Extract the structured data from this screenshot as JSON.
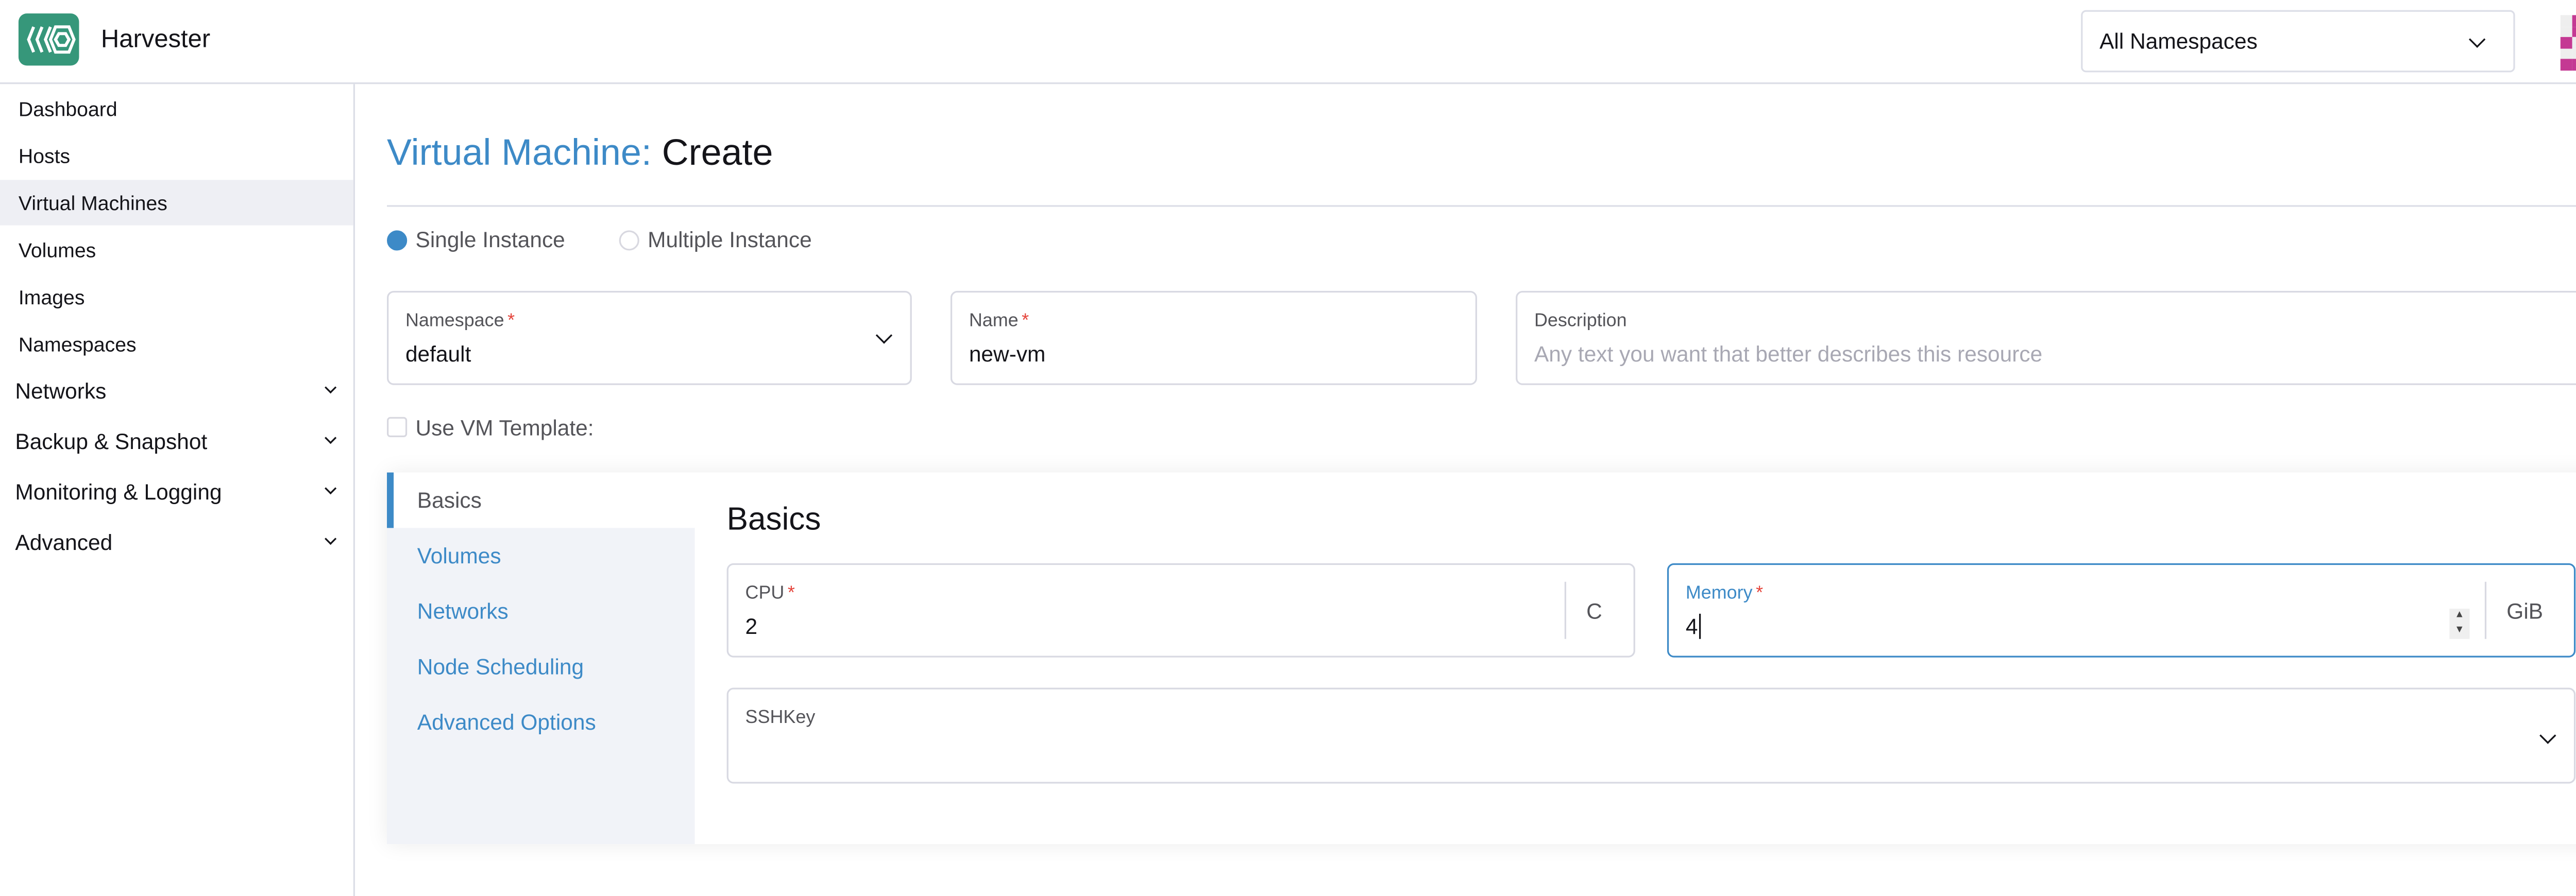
{
  "header": {
    "brand": "Harvester",
    "namespace_select": "All Namespaces",
    "logo_color": "#36977a",
    "avatar_color": "#c43993",
    "avatar_pattern": [
      [
        0,
        1,
        1,
        1,
        0
      ],
      [
        0,
        1,
        0,
        1,
        0
      ],
      [
        1,
        0,
        0,
        0,
        1
      ],
      [
        0,
        0,
        1,
        0,
        0
      ],
      [
        1,
        1,
        1,
        1,
        1
      ]
    ]
  },
  "sidebar": {
    "items": [
      {
        "label": "Dashboard"
      },
      {
        "label": "Hosts"
      },
      {
        "label": "Virtual Machines",
        "active": true
      },
      {
        "label": "Volumes"
      },
      {
        "label": "Images"
      },
      {
        "label": "Namespaces"
      }
    ],
    "groups": [
      {
        "label": "Networks"
      },
      {
        "label": "Backup & Snapshot"
      },
      {
        "label": "Monitoring & Logging"
      },
      {
        "label": "Advanced"
      }
    ]
  },
  "page": {
    "title_kind": "Virtual Machine:",
    "title_action": "Create"
  },
  "instance": {
    "single": "Single Instance",
    "multiple": "Multiple Instance",
    "selected": "single"
  },
  "form": {
    "namespace": {
      "label": "Namespace",
      "value": "default"
    },
    "name": {
      "label": "Name",
      "value": "new-vm"
    },
    "description": {
      "label": "Description",
      "placeholder": "Any text you want that better describes this resource"
    },
    "use_template": {
      "label": "Use VM Template:",
      "checked": false
    }
  },
  "tabs": [
    {
      "label": "Basics",
      "active": true
    },
    {
      "label": "Volumes"
    },
    {
      "label": "Networks"
    },
    {
      "label": "Node Scheduling"
    },
    {
      "label": "Advanced Options"
    }
  ],
  "basics": {
    "heading": "Basics",
    "cpu": {
      "label": "CPU",
      "value": "2",
      "unit": "C"
    },
    "memory": {
      "label": "Memory",
      "value": "4",
      "unit": "GiB"
    },
    "sshkey": {
      "label": "SSHKey"
    }
  },
  "colors": {
    "accent": "#3d8ac7",
    "required": "#e5443b"
  }
}
